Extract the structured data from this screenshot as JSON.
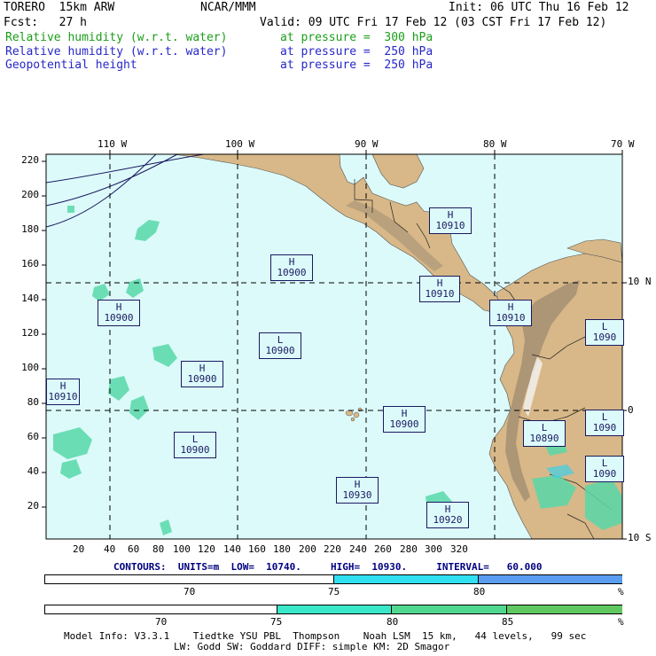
{
  "header": {
    "model": "TORERO  15km ARW",
    "center": "NCAR/MMM",
    "init": "Init: 06 UTC Thu 16 Feb 12",
    "fcst": "Fcst:   27 h",
    "valid": "Valid: 09 UTC Fri 17 Feb 12 (03 CST Fri 17 Feb 12)"
  },
  "fields": [
    {
      "name": "Relative humidity (w.r.t. water)",
      "level": "at pressure =  300 hPa",
      "color": "#1a9e1a"
    },
    {
      "name": "Relative humidity (w.r.t. water)",
      "level": "at pressure =  250 hPa",
      "color": "#2727c8"
    },
    {
      "name": "Geopotential height",
      "level": "at pressure =  250 hPa",
      "color": "#2727c8"
    }
  ],
  "map": {
    "top_axis": [
      "110 W",
      "100 W",
      "90 W",
      "80 W",
      "70 W"
    ],
    "right_axis": [
      "10 N",
      "0",
      "10 S"
    ],
    "left_axis": [
      "220",
      "200",
      "180",
      "160",
      "140",
      "120",
      "100",
      "80",
      "60",
      "40",
      "20"
    ],
    "bottom_axis": [
      "20",
      "40",
      "60",
      "80",
      "100",
      "120",
      "140",
      "160",
      "180",
      "200",
      "220",
      "240",
      "260",
      "280",
      "300",
      "320"
    ],
    "ocean_color": "#dcfafa",
    "land_color": "#d8b888",
    "highs_lows": [
      {
        "type": "H",
        "value": "10910"
      },
      {
        "type": "H",
        "value": "10900"
      },
      {
        "type": "H",
        "value": "10900"
      },
      {
        "type": "H",
        "value": "10910"
      },
      {
        "type": "L",
        "value": "10900"
      },
      {
        "type": "H",
        "value": "10910"
      },
      {
        "type": "L",
        "value": "1090"
      },
      {
        "type": "H",
        "value": "10900"
      },
      {
        "type": "H",
        "value": "10910"
      },
      {
        "type": "H",
        "value": "10900"
      },
      {
        "type": "L",
        "value": "1090"
      },
      {
        "type": "L",
        "value": "10890"
      },
      {
        "type": "L",
        "value": "10900"
      },
      {
        "type": "L",
        "value": "1090"
      },
      {
        "type": "H",
        "value": "10930"
      },
      {
        "type": "H",
        "value": "10920"
      }
    ]
  },
  "contours_line": "CONTOURS:  UNITS=m  LOW=  10740.     HIGH=  10930.     INTERVAL=   60.000",
  "colorbar_250": {
    "labels": [
      "70",
      "75",
      "80",
      "%"
    ],
    "colors": [
      "#ffffff",
      "#30e0f0",
      "#5a9cf0"
    ]
  },
  "colorbar_300": {
    "labels": [
      "70",
      "75",
      "80",
      "85",
      "%"
    ],
    "colors": [
      "#ffffff",
      "#38e8c8",
      "#50d890",
      "#60c860"
    ]
  },
  "footer": {
    "line1": "Model Info: V3.3.1    Tiedtke YSU PBL  Thompson    Noah LSM  15 km,   44 levels,   99 sec",
    "line2": "LW: Godd SW: Goddard DIFF: simple KM: 2D Smagor"
  }
}
